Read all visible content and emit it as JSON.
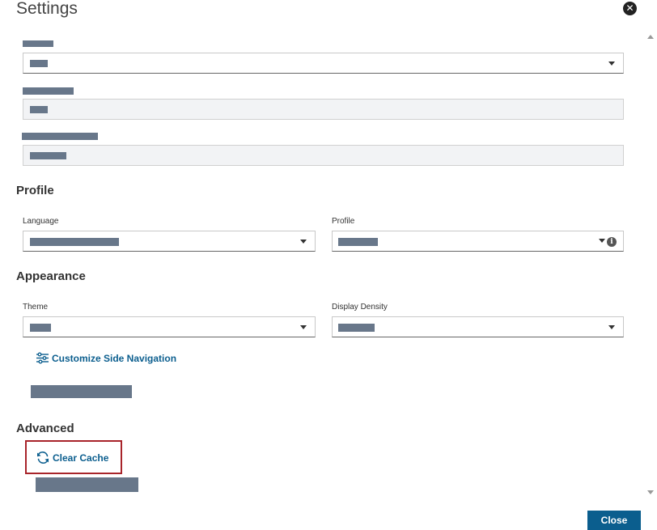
{
  "dialog": {
    "title": "Settings"
  },
  "profile_section": {
    "heading": "Profile",
    "language_label": "Language",
    "profile_label": "Profile"
  },
  "appearance_section": {
    "heading": "Appearance",
    "theme_label": "Theme",
    "density_label": "Display Density",
    "customize_nav_label": "Customize Side Navigation"
  },
  "advanced_section": {
    "heading": "Advanced",
    "clear_cache_label": "Clear Cache"
  },
  "footer": {
    "close_label": "Close"
  },
  "colors": {
    "accent": "#0b5e8e",
    "highlight_border": "#a8242a",
    "redaction": "#68778a"
  },
  "icons": {
    "close": "close-circle-icon",
    "caret": "chevron-down-icon",
    "info": "info-icon",
    "sliders": "sliders-icon",
    "refresh": "refresh-icon"
  }
}
